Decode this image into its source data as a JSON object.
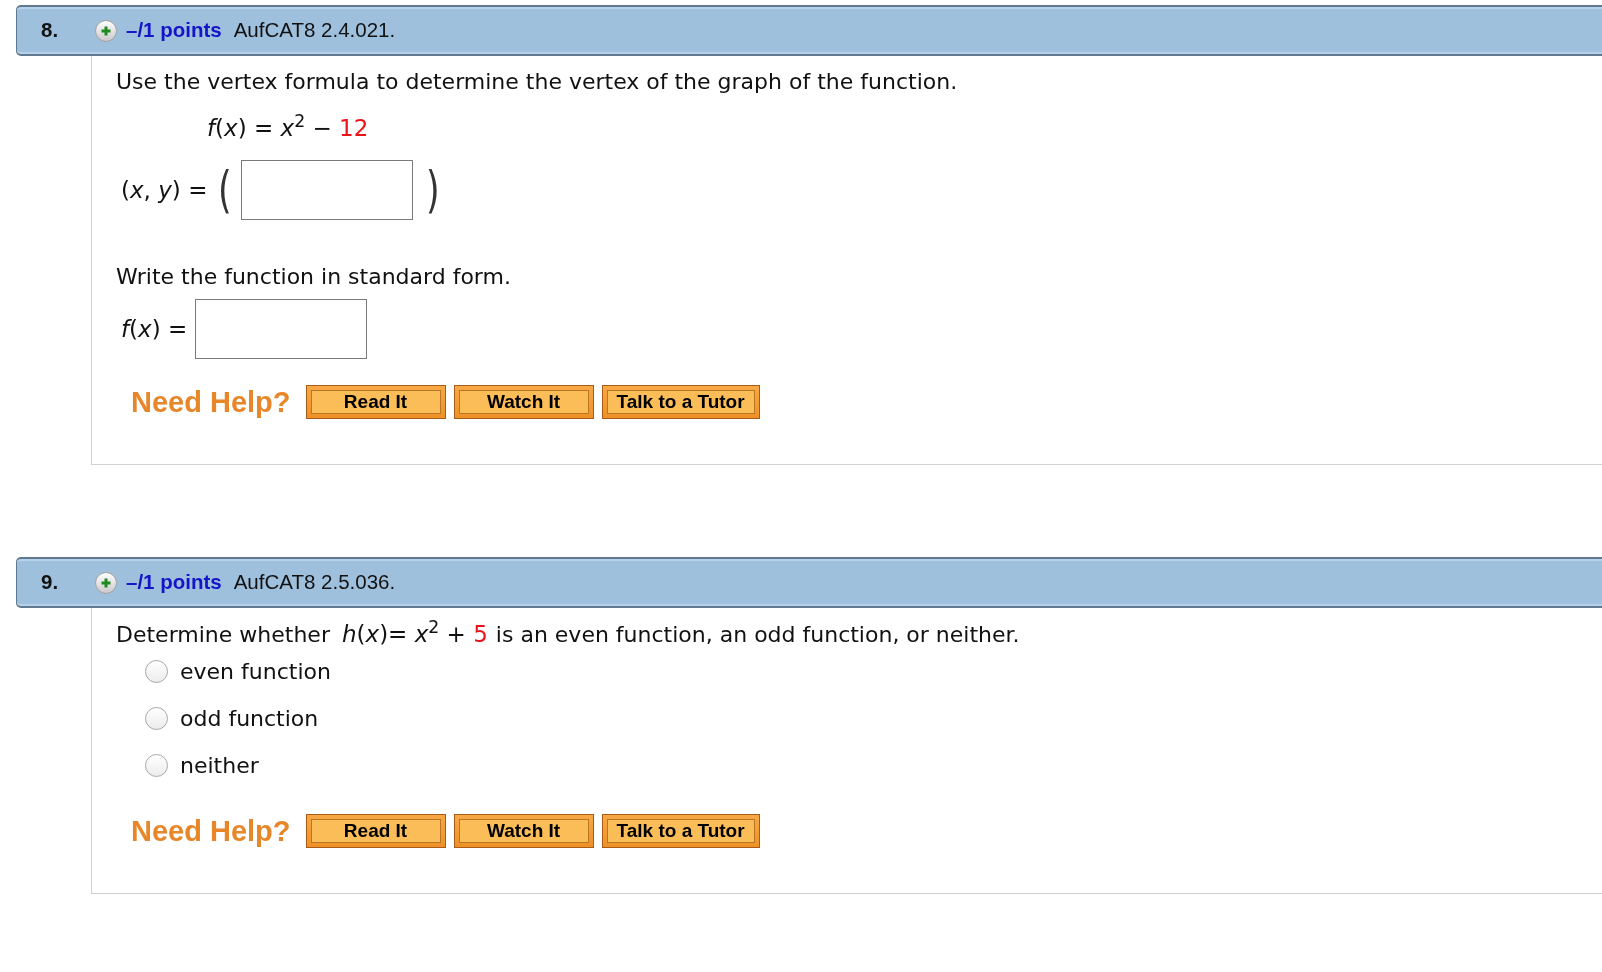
{
  "questions": [
    {
      "number": "8.",
      "points": "–/1 points",
      "code": "AufCAT8 2.4.021.",
      "parts": [
        {
          "kind": "text",
          "text": "Use the vertex formula to determine the vertex of the graph of the function."
        },
        {
          "kind": "formula",
          "expr": "*f*(*x*) = *x*$^{2}$ −",
          "value": "12"
        },
        {
          "kind": "answer",
          "label": "(*x*, *y*) =",
          "open": "(",
          "close": ")"
        },
        {
          "kind": "text",
          "text": "Write the function in standard form."
        },
        {
          "kind": "answer",
          "label": "*f*(*x*) ="
        }
      ],
      "help": {
        "label": "Need Help?",
        "buttons": [
          "Read It",
          "Watch It",
          "Talk to a Tutor"
        ]
      }
    },
    {
      "number": "9.",
      "points": "–/1 points",
      "code": "AufCAT8 2.5.036.",
      "parts": [
        {
          "kind": "prompt",
          "before": "Determine whether",
          "expr": "*h*(*x*)= *x*$^{2}$ +",
          "value": "5",
          "after": "is an even function, an odd function, or neither."
        },
        {
          "kind": "choices",
          "options": [
            {
              "label": "even function",
              "selected": false
            },
            {
              "label": "odd function",
              "selected": false
            },
            {
              "label": "neither",
              "selected": false
            }
          ]
        }
      ],
      "help": {
        "label": "Need Help?",
        "buttons": [
          "Read It",
          "Watch It",
          "Talk to a Tutor"
        ]
      }
    }
  ]
}
